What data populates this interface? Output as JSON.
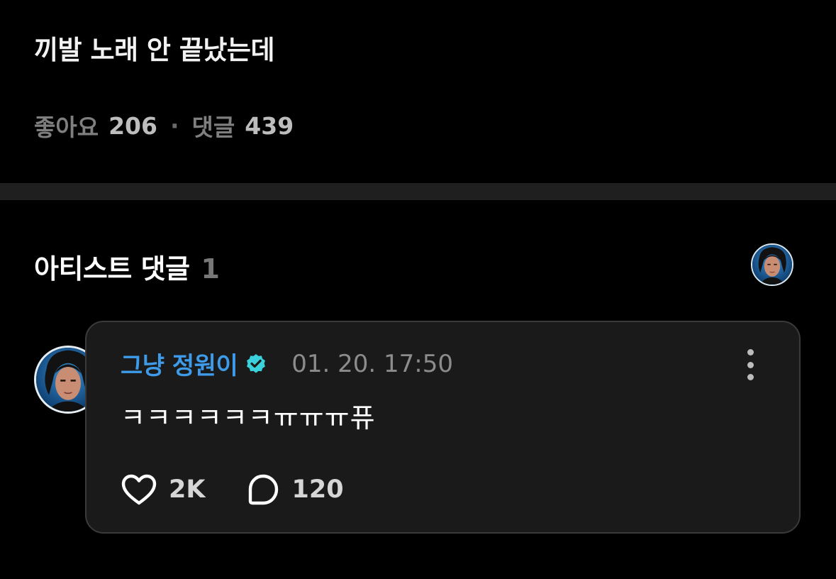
{
  "post": {
    "title": "끼발 노래 안 끝났는데",
    "likes_label": "좋아요",
    "likes_count": "206",
    "separator": "·",
    "comments_label": "댓글",
    "comments_count": "439"
  },
  "artist_section": {
    "title": "아티스트 댓글",
    "count": "1"
  },
  "comment": {
    "author": "그냥 정원이",
    "timestamp": "01. 20. 17:50",
    "text": "ㅋㅋㅋㅋㅋㅋㅠㅠㅠ퓨",
    "likes": "2K",
    "replies": "120"
  },
  "colors": {
    "author": "#3d9be9",
    "verified_badge": "#3ad0dc"
  },
  "icons": {
    "verified": "verified-badge-icon",
    "more": "more-vertical-icon",
    "like": "heart-icon",
    "reply": "comment-bubble-icon"
  }
}
